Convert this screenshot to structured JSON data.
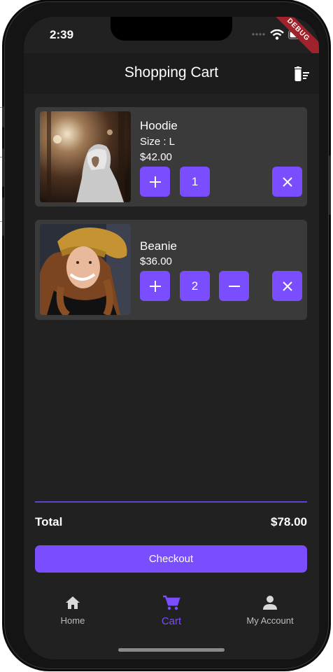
{
  "status": {
    "time": "2:39",
    "debug_label": "DEBUG"
  },
  "appbar": {
    "title": "Shopping Cart"
  },
  "cart": {
    "items": [
      {
        "name": "Hoodie",
        "size": "Size : L",
        "price": "$42.00",
        "quantity": "1"
      },
      {
        "name": "Beanie",
        "price": "$36.00",
        "quantity": "2"
      }
    ]
  },
  "summary": {
    "total_label": "Total",
    "total_value": "$78.00"
  },
  "checkout": {
    "label": "Checkout"
  },
  "nav": {
    "items": [
      {
        "label": "Home",
        "icon": "home-icon"
      },
      {
        "label": "Cart",
        "icon": "cart-icon",
        "active": true
      },
      {
        "label": "My Account",
        "icon": "person-icon"
      }
    ]
  },
  "colors": {
    "accent": "#7a4dff",
    "background": "#212121",
    "card": "#3a3a3a"
  }
}
